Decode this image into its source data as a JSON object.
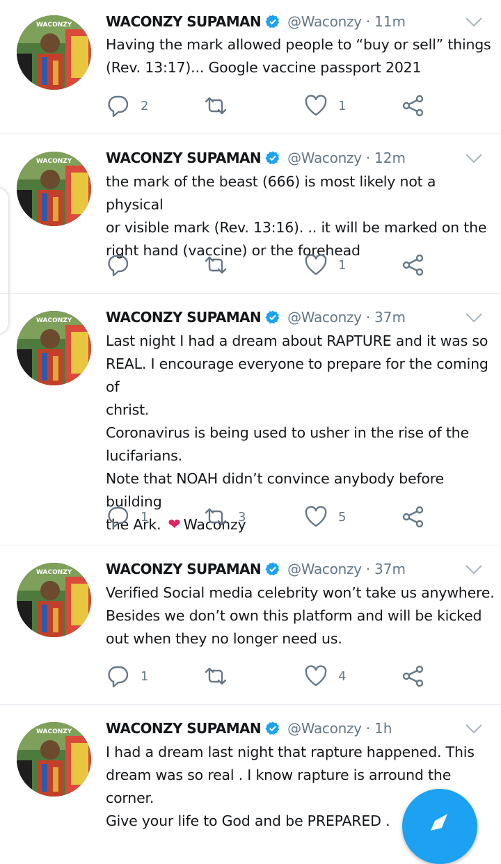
{
  "tweets": [
    {
      "name": "WACONZY SUPAMAN",
      "handle": "@Waconzy",
      "separator": "·",
      "time": "11m",
      "lines": [
        "Having the mark allowed people to “buy or sell” things",
        "(Rev. 13:17)... Google vaccine passport 2021"
      ],
      "replies": "2",
      "retweets": "",
      "likes": "1"
    },
    {
      "name": "WACONZY SUPAMAN",
      "handle": "@Waconzy",
      "separator": "·",
      "time": "12m",
      "lines": [
        "the mark of the beast (666) is most likely not a physical",
        "or visible mark (Rev. 13:16). .. it will be marked on the",
        "right hand (vaccine) or the forehead"
      ],
      "replies": "",
      "retweets": "",
      "likes": "1"
    },
    {
      "name": "WACONZY SUPAMAN",
      "handle": "@Waconzy",
      "separator": "·",
      "time": "37m",
      "lines": [
        "Last night I had a dream about RAPTURE and it was so",
        "REAL. I encourage everyone to prepare for the coming of",
        "christ.",
        "Coronavirus is being used to usher in the rise of the",
        "lucifarians.",
        "Note that NOAH didn’t convince anybody before building",
        "the Ark."
      ],
      "emoji": "❤",
      "signoff": "Waconzy",
      "replies": "1",
      "retweets": "3",
      "likes": "5"
    },
    {
      "name": "WACONZY SUPAMAN",
      "handle": "@Waconzy",
      "separator": "·",
      "time": "37m",
      "lines": [
        "Verified Social media celebrity won’t take us anywhere.",
        "Besides we don’t own this platform and will be kicked",
        "out when they no longer need us."
      ],
      "replies": "1",
      "retweets": "",
      "likes": "4"
    },
    {
      "name": "WACONZY SUPAMAN",
      "handle": "@Waconzy",
      "separator": "·",
      "time": "1h",
      "lines": [
        "I had a dream last night that rapture happened. This",
        "dream was so real . I know rapture is arround the corner.",
        "Give your life to God and be PREPARED ."
      ],
      "replies": "",
      "retweets": "",
      "likes": ""
    }
  ],
  "icons": {
    "reply": "reply-icon",
    "retweet": "retweet-icon",
    "like": "heart-icon",
    "share": "share-icon",
    "more": "chevron-down-icon",
    "verified": "verified-badge-icon",
    "compose": "compose-icon"
  },
  "colors": {
    "accent": "#1da1f2",
    "muted": "#657786",
    "text": "#14171a",
    "heart": "#e0245e",
    "divider": "#e1e8ed"
  }
}
